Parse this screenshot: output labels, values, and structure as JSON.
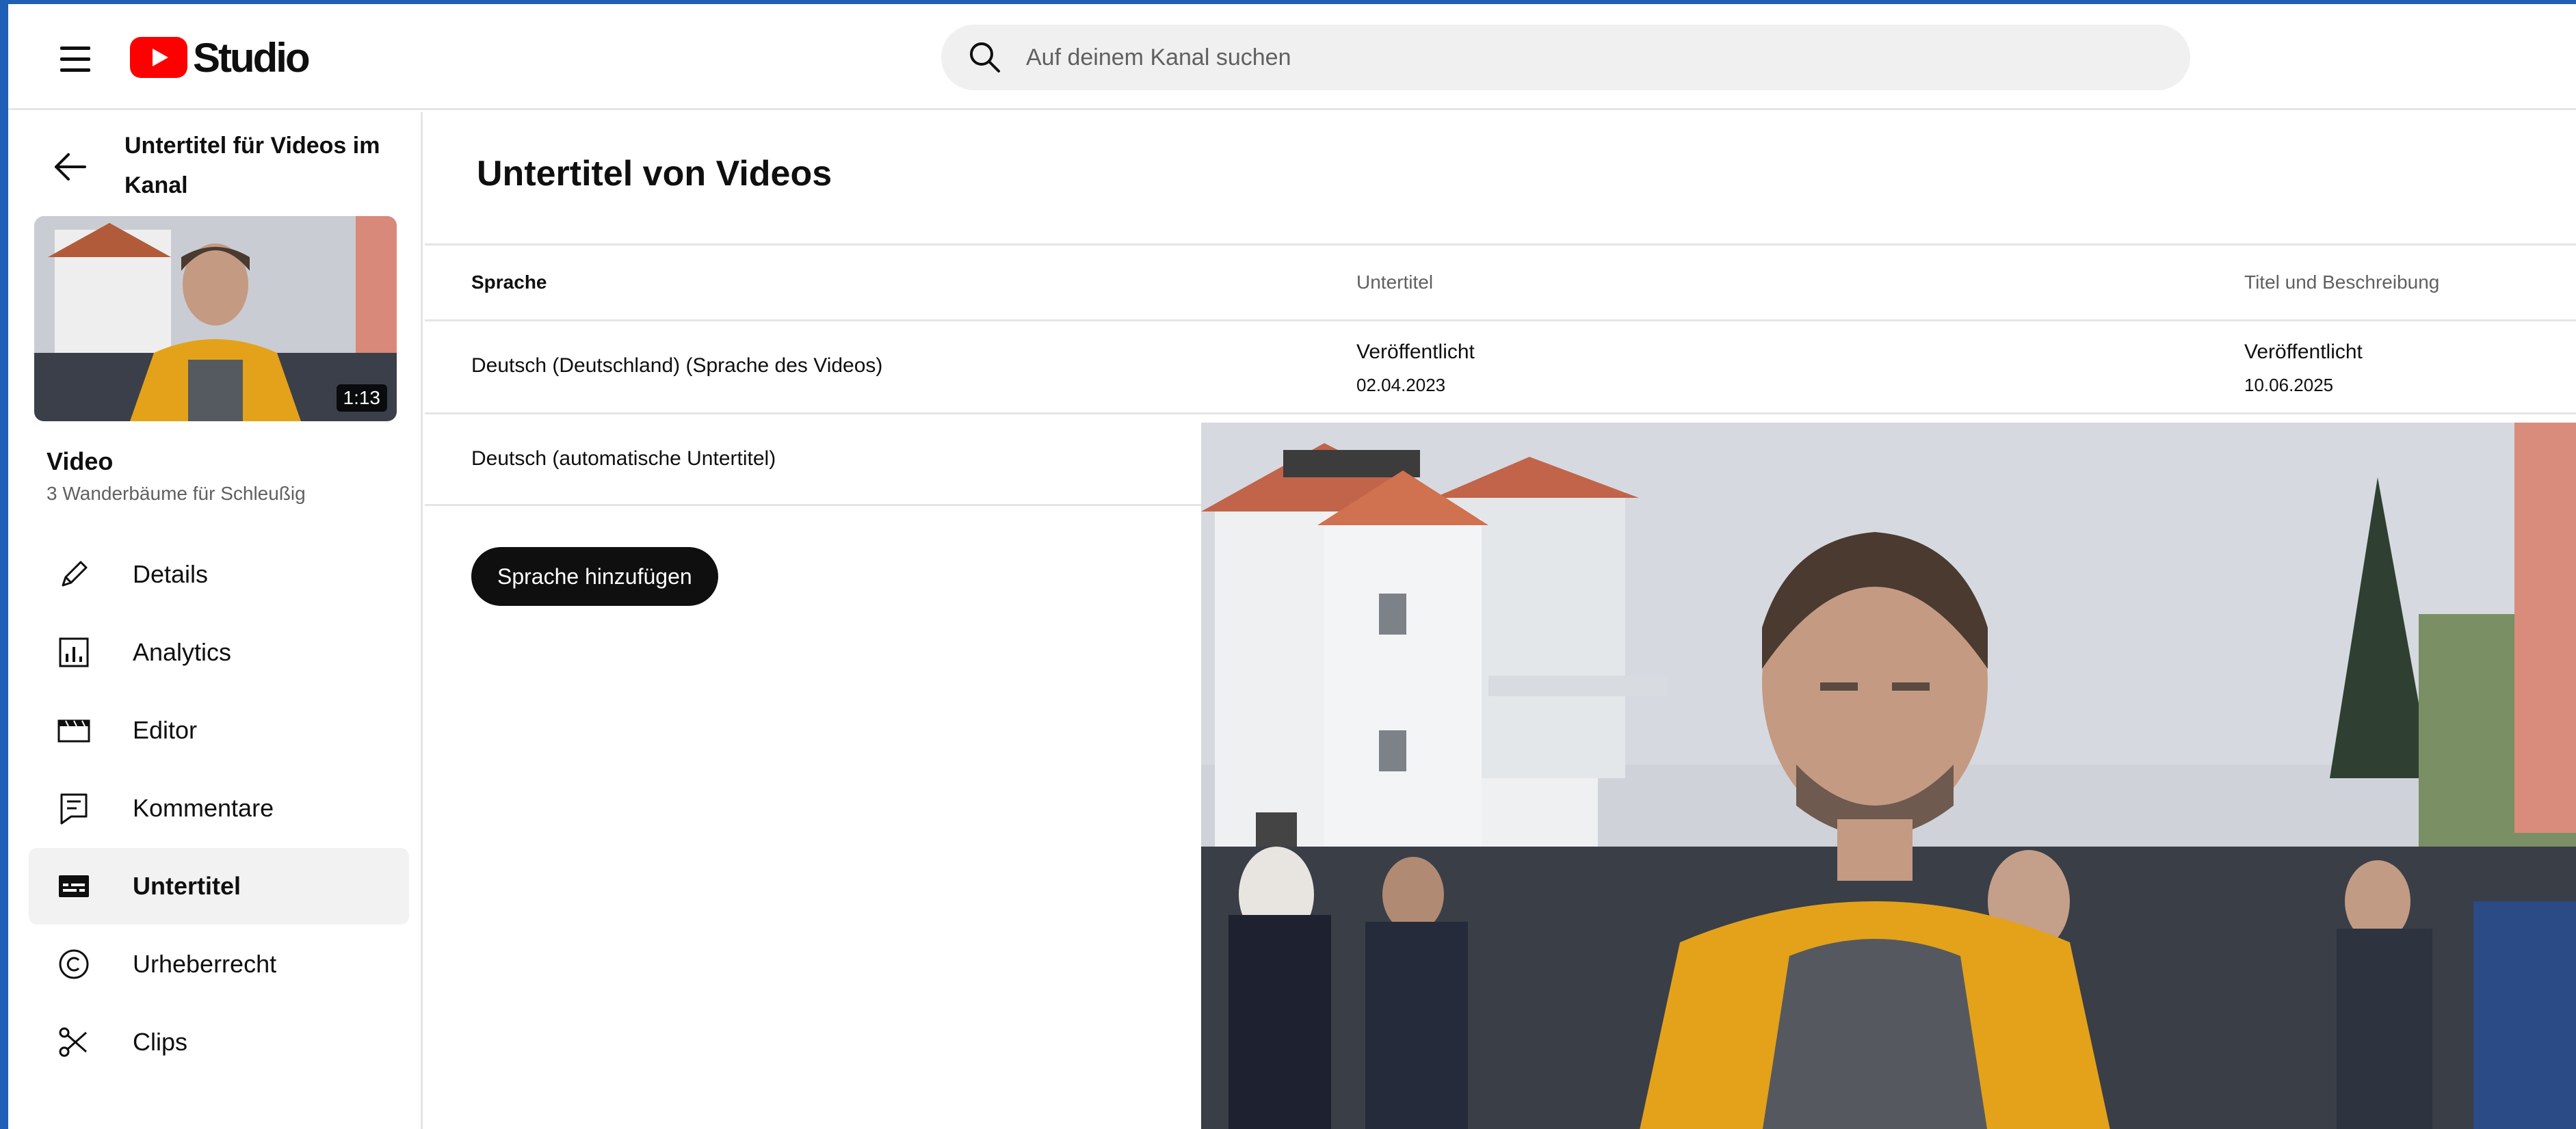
{
  "header": {
    "logo_text": "Studio",
    "search_placeholder": "Auf deinem Kanal suchen"
  },
  "sidebar": {
    "back_title": "Untertitel für Videos im Kanal",
    "thumbnail_duration": "1:13",
    "section_label": "Video",
    "video_title": "3 Wanderbäume für Schleußig",
    "nav": [
      {
        "label": "Details",
        "icon": "pencil-icon",
        "active": false
      },
      {
        "label": "Analytics",
        "icon": "analytics-icon",
        "active": false
      },
      {
        "label": "Editor",
        "icon": "clapperboard-icon",
        "active": false
      },
      {
        "label": "Kommentare",
        "icon": "comment-icon",
        "active": false
      },
      {
        "label": "Untertitel",
        "icon": "subtitles-icon",
        "active": true
      },
      {
        "label": "Urheberrecht",
        "icon": "copyright-icon",
        "active": false
      },
      {
        "label": "Clips",
        "icon": "scissors-icon",
        "active": false
      }
    ]
  },
  "main": {
    "title": "Untertitel von Videos",
    "columns": [
      "Sprache",
      "Untertitel",
      "Titel und Beschreibung"
    ],
    "rows": [
      {
        "language": "Deutsch (Deutschland) (Sprache des Videos)",
        "subtitles_status": "Veröffentlicht",
        "subtitles_date": "02.04.2023",
        "meta_status": "Veröffentlicht",
        "meta_date": "10.06.2025"
      },
      {
        "language": "Deutsch (automatische Untertitel)"
      }
    ],
    "add_language_label": "Sprache hinzufügen"
  },
  "colors": {
    "accent": "#ff0000",
    "text": "#0f0f0f",
    "secondary_text": "#606060",
    "active_nav_bg": "#f2f2f2",
    "window_border": "#1f5fb5"
  }
}
